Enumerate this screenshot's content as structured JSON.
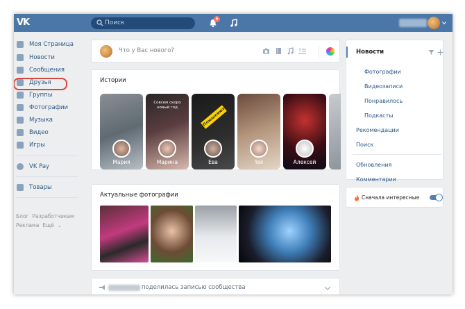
{
  "header": {
    "logo": "VK",
    "search_placeholder": "Поиск",
    "notifications_count": "6"
  },
  "sidebar": {
    "items": [
      {
        "label": "Моя Страница",
        "icon": "home-icon"
      },
      {
        "label": "Новости",
        "icon": "news-icon"
      },
      {
        "label": "Сообщения",
        "icon": "messages-icon"
      },
      {
        "label": "Друзья",
        "icon": "friends-icon"
      },
      {
        "label": "Группы",
        "icon": "groups-icon"
      },
      {
        "label": "Фотографии",
        "icon": "camera-icon"
      },
      {
        "label": "Музыка",
        "icon": "music-icon"
      },
      {
        "label": "Видео",
        "icon": "video-icon"
      },
      {
        "label": "Игры",
        "icon": "games-icon"
      },
      {
        "label": "VK Pay",
        "icon": "vkpay-icon"
      },
      {
        "label": "Товары",
        "icon": "market-icon"
      }
    ],
    "footer": {
      "links_row1": [
        "Блог",
        "Разработчикам"
      ],
      "links_row2": [
        "Реклама",
        "Ещё"
      ]
    }
  },
  "composer": {
    "placeholder": "Что у Вас нового?"
  },
  "stories": {
    "title": "Истории",
    "items": [
      {
        "name": "Мария",
        "caption": ""
      },
      {
        "name": "Марина",
        "caption": "Совсем скоро новый год"
      },
      {
        "name": "Ева",
        "caption": "Плюшкиюз"
      },
      {
        "name": "Yaii",
        "caption": ""
      },
      {
        "name": "Алексей",
        "caption": ""
      }
    ]
  },
  "photos": {
    "title": "Актуальные фотографии"
  },
  "post": {
    "action_text": "поделилась записью сообщества"
  },
  "right_menu": {
    "header": "Новости",
    "sub_items": [
      "Фотографии",
      "Видеозаписи",
      "Понравилось",
      "Подкасты"
    ],
    "items_mid": [
      "Рекомендации",
      "Поиск"
    ],
    "items_bottom": [
      "Обновления",
      "Комментарии"
    ]
  },
  "toggle": {
    "label": "Сначала интересные",
    "enabled": true
  },
  "colors": {
    "brand": "#4a76a8",
    "link": "#2a5885",
    "highlight": "#d8453c"
  }
}
